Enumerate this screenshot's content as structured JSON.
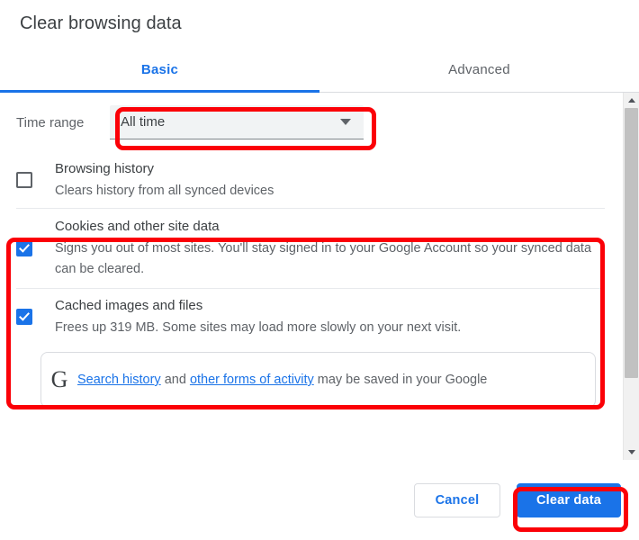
{
  "dialog": {
    "title": "Clear browsing data"
  },
  "tabs": [
    {
      "label": "Basic",
      "active": true
    },
    {
      "label": "Advanced",
      "active": false
    }
  ],
  "time_range": {
    "label": "Time range",
    "selected": "All time",
    "caret_icon": "chevron-down-icon"
  },
  "options": [
    {
      "title": "Browsing history",
      "subtitle": "Clears history from all synced devices",
      "checked": false
    },
    {
      "title": "Cookies and other site data",
      "subtitle": "Signs you out of most sites. You'll stay signed in to your Google Account so your synced data can be cleared.",
      "checked": true
    },
    {
      "title": "Cached images and files",
      "subtitle": "Frees up 319 MB. Some sites may load more slowly on your next visit.",
      "checked": true
    }
  ],
  "google_notice": {
    "logo_icon": "google-g-icon",
    "link1": "Search history",
    "mid": " and ",
    "link2": "other forms of activity",
    "tail": " may be saved in your Google"
  },
  "footer": {
    "cancel_label": "Cancel",
    "clear_label": "Clear data"
  },
  "scrollbar": {
    "up_icon": "scroll-up-arrow-icon",
    "down_icon": "scroll-down-arrow-icon"
  },
  "colors": {
    "accent": "#1a73e8",
    "highlight": "#fb0007",
    "text_primary": "#3c4043",
    "text_secondary": "#5f6368"
  }
}
